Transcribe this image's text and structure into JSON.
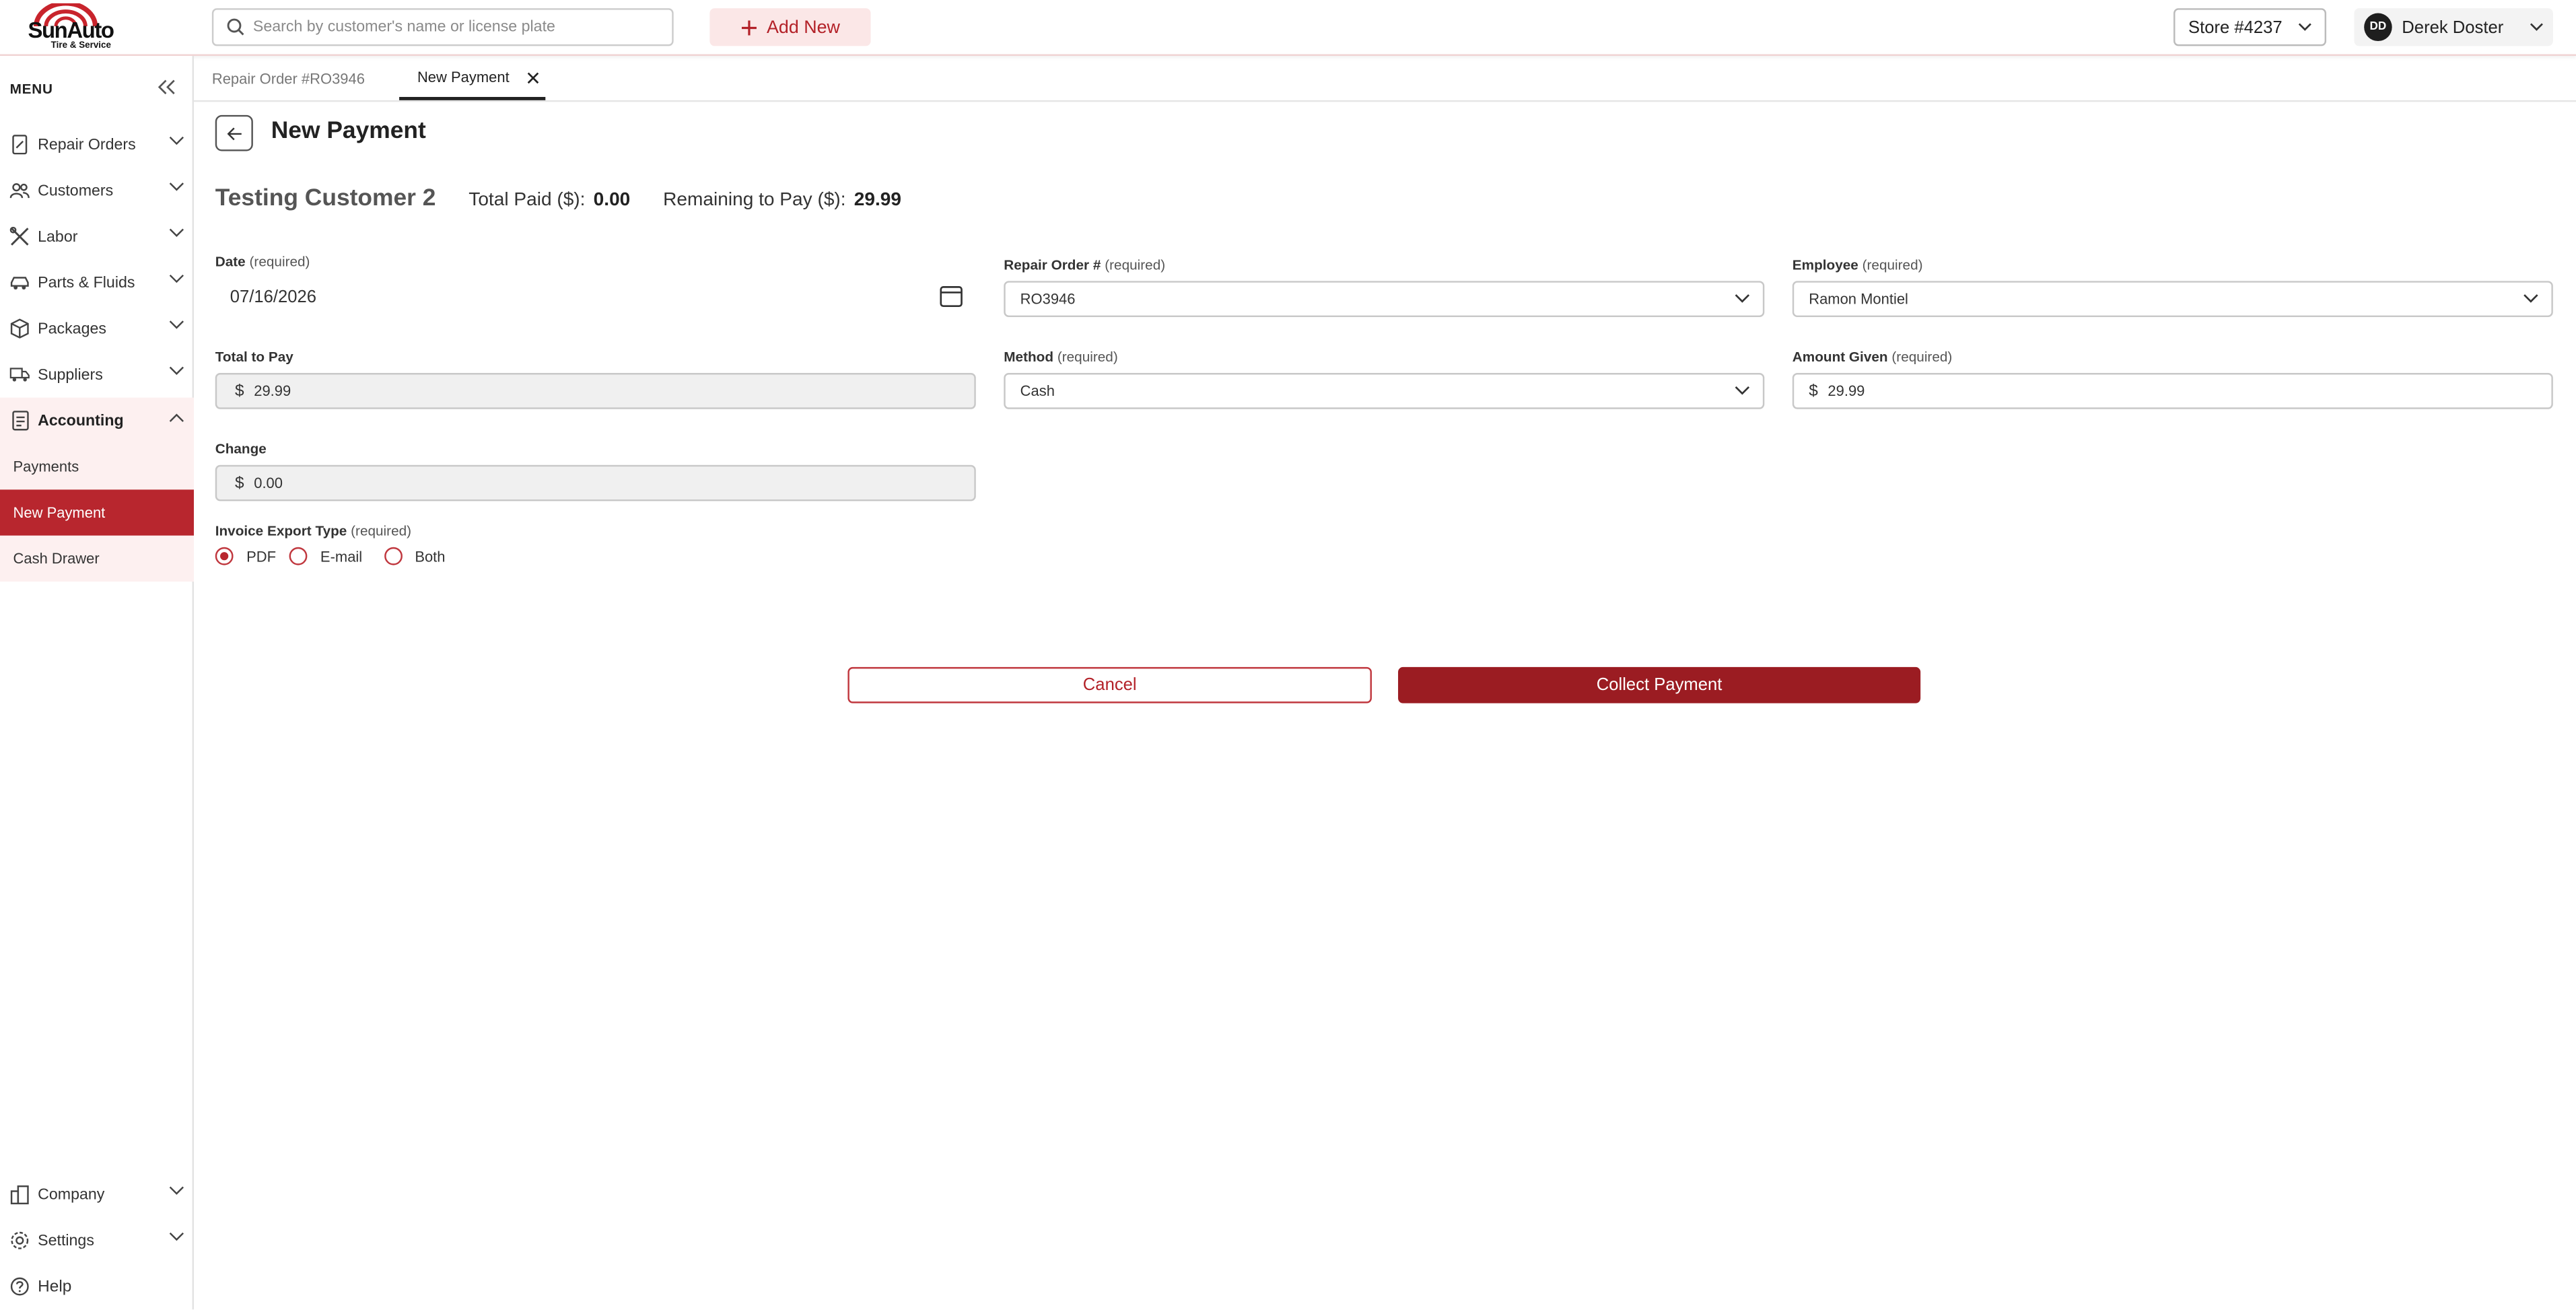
{
  "brand": {
    "name": "SunAuto",
    "tagline": "Tire & Service",
    "accent": "#b8262e",
    "accent_dark": "#9b1c22"
  },
  "header": {
    "search_placeholder": "Search by customer's name or license plate",
    "add_new_label": "Add New",
    "store_label": "Store #4237",
    "user_initials": "DD",
    "user_name": "Derek Doster"
  },
  "sidebar": {
    "menu_label": "MENU",
    "items": [
      {
        "label": "Repair Orders",
        "icon": "document-edit-icon"
      },
      {
        "label": "Customers",
        "icon": "users-icon"
      },
      {
        "label": "Labor",
        "icon": "tools-icon"
      },
      {
        "label": "Parts & Fluids",
        "icon": "car-icon"
      },
      {
        "label": "Packages",
        "icon": "package-icon"
      },
      {
        "label": "Suppliers",
        "icon": "truck-icon"
      },
      {
        "label": "Accounting",
        "icon": "ledger-icon"
      }
    ],
    "accounting_sub": [
      "Payments",
      "New Payment",
      "Cash Drawer"
    ],
    "bottom": [
      {
        "label": "Company",
        "icon": "building-icon"
      },
      {
        "label": "Settings",
        "icon": "gear-icon"
      },
      {
        "label": "Help",
        "icon": "help-icon"
      }
    ]
  },
  "tabs": [
    {
      "label": "Repair Order #RO3946"
    },
    {
      "label": "New Payment"
    }
  ],
  "page": {
    "title": "New Payment",
    "customer_name": "Testing Customer 2",
    "total_paid_label": "Total Paid ($):",
    "total_paid_value": "0.00",
    "remaining_label": "Remaining to Pay ($):",
    "remaining_value": "29.99"
  },
  "form": {
    "required_text": "(required)",
    "date": {
      "label": "Date",
      "value": "07/16/2026"
    },
    "repair_order": {
      "label": "Repair Order #",
      "value": "RO3946"
    },
    "employee": {
      "label": "Employee",
      "value": "Ramon Montiel"
    },
    "total_to_pay": {
      "label": "Total to Pay",
      "currency": "$",
      "value": "29.99"
    },
    "method": {
      "label": "Method",
      "value": "Cash"
    },
    "amount_given": {
      "label": "Amount Given",
      "currency": "$",
      "value": "29.99"
    },
    "change": {
      "label": "Change",
      "currency": "$",
      "value": "0.00"
    },
    "invoice_export": {
      "label": "Invoice Export Type",
      "options": [
        "PDF",
        "E-mail",
        "Both"
      ],
      "selected": "PDF"
    }
  },
  "actions": {
    "cancel_label": "Cancel",
    "collect_label": "Collect Payment"
  }
}
